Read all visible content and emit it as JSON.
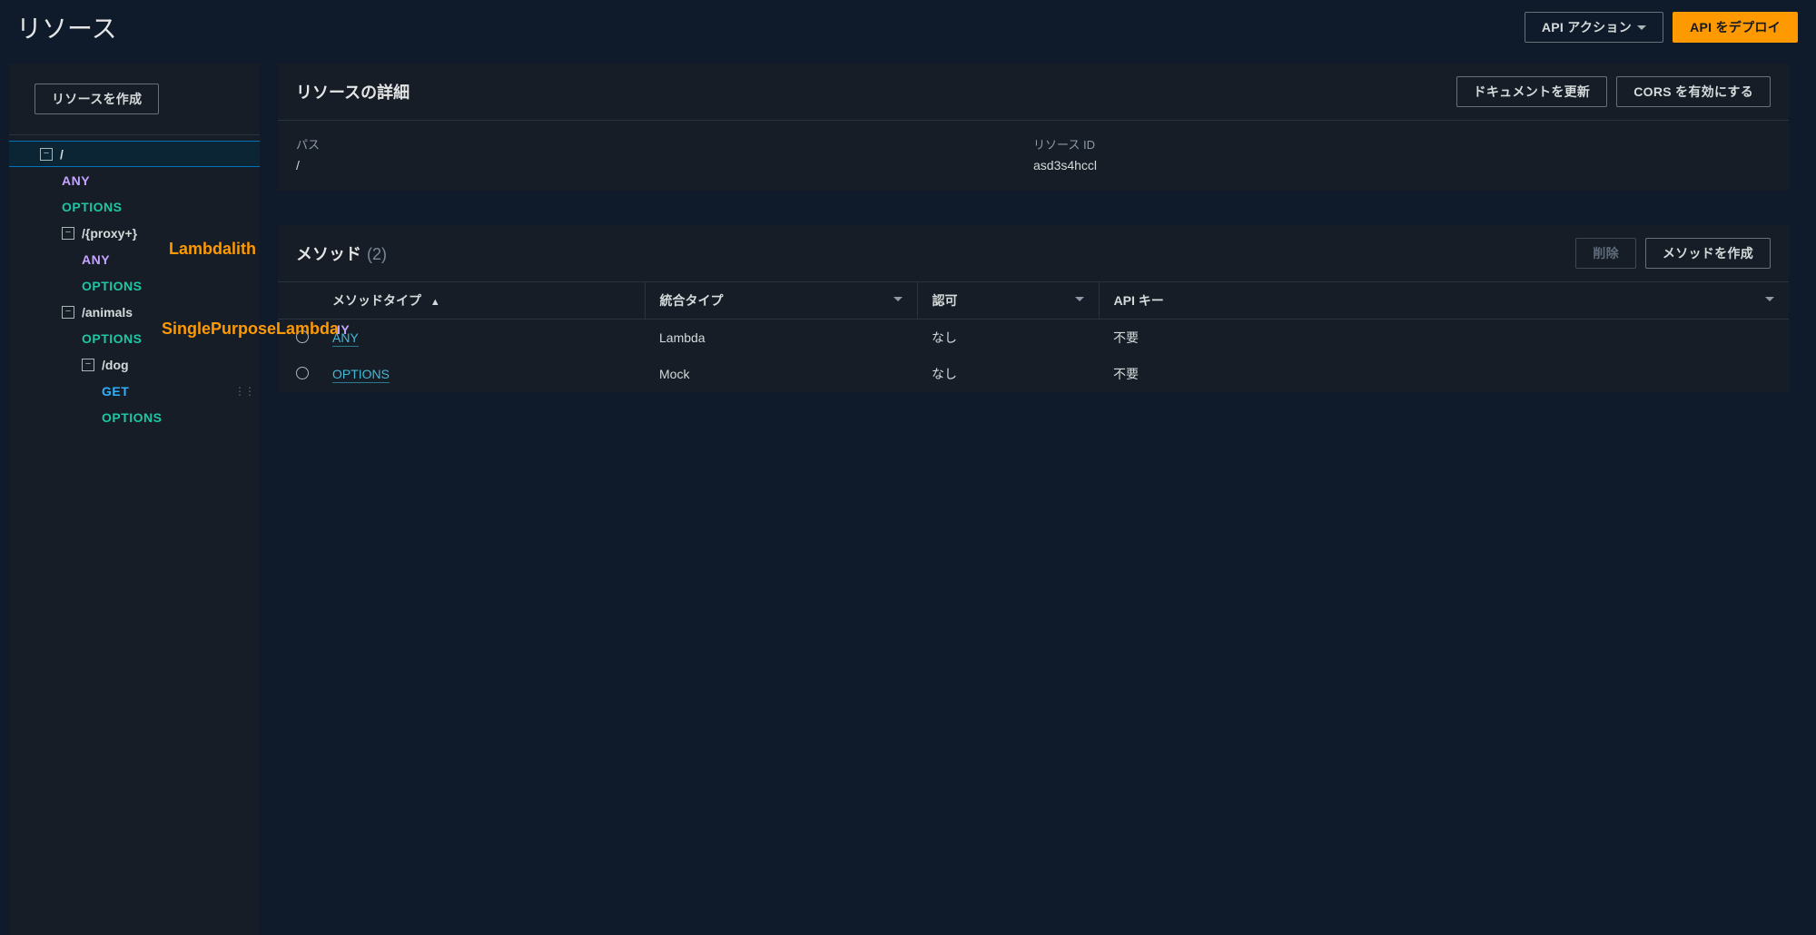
{
  "header": {
    "title": "リソース",
    "api_actions_label": "API アクション",
    "deploy_label": "API をデプロイ"
  },
  "sidebar": {
    "create_resource_label": "リソースを作成",
    "tree": {
      "root": {
        "label": "/",
        "selected": true
      },
      "root_any": "ANY",
      "root_options": "OPTIONS",
      "proxy": {
        "label": "/{proxy+}"
      },
      "proxy_any": "ANY",
      "proxy_options": "OPTIONS",
      "animals": {
        "label": "/animals"
      },
      "animals_any_suffix": "IY",
      "animals_options": "OPTIONS",
      "dog": {
        "label": "/dog"
      },
      "dog_get": "GET",
      "dog_options": "OPTIONS"
    },
    "annotations": {
      "lambdalith": "Lambdalith",
      "spl": "SinglePurposeLambda"
    }
  },
  "details_panel": {
    "title": "リソースの詳細",
    "update_docs_label": "ドキュメントを更新",
    "enable_cors_label": "CORS を有効にする",
    "path_label": "パス",
    "path_value": "/",
    "resource_id_label": "リソース ID",
    "resource_id_value": "asd3s4hccl"
  },
  "methods_panel": {
    "title": "メソッド",
    "count": "(2)",
    "delete_label": "削除",
    "create_method_label": "メソッドを作成",
    "columns": {
      "method_type": "メソッドタイプ",
      "integration_type": "統合タイプ",
      "authorization": "認可",
      "api_key": "API キー"
    },
    "rows": [
      {
        "method": "ANY",
        "integration": "Lambda",
        "auth": "なし",
        "apikey": "不要"
      },
      {
        "method": "OPTIONS",
        "integration": "Mock",
        "auth": "なし",
        "apikey": "不要"
      }
    ]
  }
}
